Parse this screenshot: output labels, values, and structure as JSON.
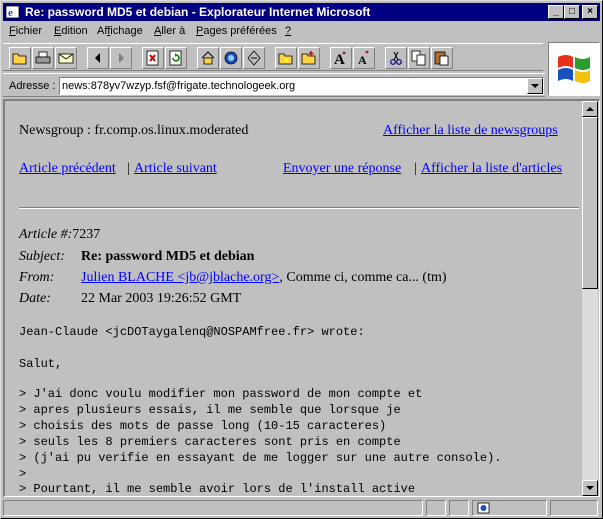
{
  "window": {
    "title": "Re: password MD5 et debian - Explorateur Internet Microsoft",
    "minimize_glyph": "_",
    "maximize_glyph": "□",
    "close_glyph": "×"
  },
  "menu": [
    {
      "pre": "",
      "ul": "F",
      "post": "ichier"
    },
    {
      "pre": "",
      "ul": "E",
      "post": "dition"
    },
    {
      "pre": "Af",
      "ul": "f",
      "post": "ichage"
    },
    {
      "pre": "",
      "ul": "A",
      "post": "ller à"
    },
    {
      "pre": "",
      "ul": "P",
      "post": "ages préférées"
    },
    {
      "pre": "",
      "ul": "?",
      "post": ""
    }
  ],
  "toolbar": {
    "icons": [
      "open-folder-icon",
      "print-icon",
      "mail-icon",
      "back-arrow-icon",
      "forward-arrow-icon",
      "stop-icon",
      "refresh-icon",
      "home-icon",
      "search-icon",
      "history-icon",
      "favorites-folder-icon",
      "add-favorite-icon",
      "font-larger-icon",
      "font-smaller-icon",
      "cut-icon",
      "copy-icon",
      "paste-icon"
    ],
    "font_larger_label": "A",
    "font_smaller_label": "A"
  },
  "address": {
    "label": "Adresse :",
    "value": "news:878yv7wzyp.fsf@frigate.technologeek.org"
  },
  "nav": {
    "newsgroup_label": "Newsgroup : fr.comp.os.linux.moderated",
    "show_newsgroups": "Afficher la liste de newsgroups",
    "prev_article": "Article précédent",
    "separator": "|",
    "next_article": "Article suivant",
    "send_reply": "Envoyer une réponse",
    "show_articles": "Afficher la liste d'articles"
  },
  "article": {
    "number_label": "Article #:",
    "number": "7237",
    "subject_label": "Subject:",
    "subject": "Re: password MD5 et debian",
    "from_label": "From:",
    "from_link": "Julien BLACHE <jb@jblache.org>",
    "from_extra": ", Comme ci, comme ca... (tm)",
    "date_label": "Date:",
    "date": "22 Mar 2003 19:26:52 GMT"
  },
  "body_lines": [
    "Jean-Claude <jcDOTaygalenq@NOSPAMfree.fr> wrote:",
    "",
    "Salut,",
    "",
    "> J'ai donc voulu modifier mon password de mon compte et",
    "> apres plusieurs essais, il me semble que lorsque je",
    "> choisis des mots de passe long (10-15 caracteres)",
    "> seuls les 8 premiers caracteres sont pris en compte",
    "> (j'ai pu verifie en essayant de me logger sur une autre console).",
    ">",
    "> Pourtant, il me semble avoir lors de l'install active"
  ],
  "colors": {
    "titlebar": "#000080",
    "link": "#0000ff",
    "face": "#c0c0c0"
  }
}
